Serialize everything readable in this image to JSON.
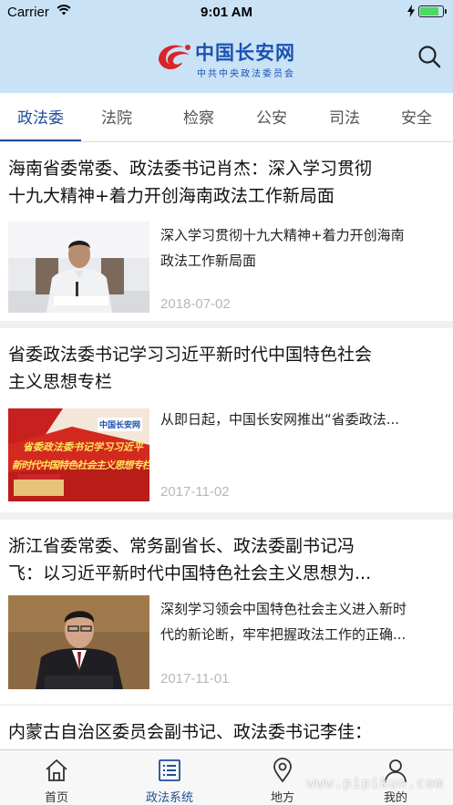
{
  "status_bar": {
    "carrier": "Carrier",
    "time": "9:01 AM",
    "battery_level": 0.9
  },
  "header": {
    "logo_title": "中国长安网",
    "logo_subtitle": "中共中央政法委员会",
    "brand_color": "#1c52b0",
    "logo_color": "#d8242a"
  },
  "tabs": [
    {
      "label": "政法委",
      "active": true
    },
    {
      "label": "法院",
      "active": false
    },
    {
      "label": "检察",
      "active": false
    },
    {
      "label": "公安",
      "active": false
    },
    {
      "label": "司法",
      "active": false
    },
    {
      "label": "安全",
      "active": false
    }
  ],
  "articles": [
    {
      "title": "海南省委常委、政法委书记肖杰：深入学习贯彻\n十九大精神+着力开创海南政法工作新局面",
      "summary": "深入学习贯彻十九大精神+着力开创海南\n政法工作新局面",
      "date": "2018-07-02"
    },
    {
      "title": "省委政法委书记学习习近平新时代中国特色社会\n主义思想专栏",
      "summary": "从即日起，中国长安网推出“省委政法...",
      "date": "2017-11-02",
      "thumb_text_logo": "中国长安网",
      "thumb_text_line1": "省委政法委书记学习习近平",
      "thumb_text_line2": "新时代中国特色社会主义思想专栏"
    },
    {
      "title": "浙江省委常委、常务副省长、政法委副书记冯\n飞：以习近平新时代中国特色社会主义思想为...",
      "summary": "深刻学习领会中国特色社会主义进入新时\n代的新论断，牢牢把握政法工作的正确...",
      "date": "2017-11-01"
    },
    {
      "title": "内蒙古自治区委员会副书记、政法委书记李佳：\n高举旗帜，维护核心，以新的精神状态和奋斗姿",
      "summary": "",
      "date": ""
    }
  ],
  "tabbar": [
    {
      "label": "首页",
      "icon": "home-icon",
      "active": false
    },
    {
      "label": "政法系统",
      "icon": "list-icon",
      "active": true
    },
    {
      "label": "地方",
      "icon": "location-pin-icon",
      "active": false
    },
    {
      "label": "我的",
      "icon": "person-icon",
      "active": false
    }
  ],
  "accent_color": "#1f4e9a",
  "watermark": "www.pipikun.com"
}
